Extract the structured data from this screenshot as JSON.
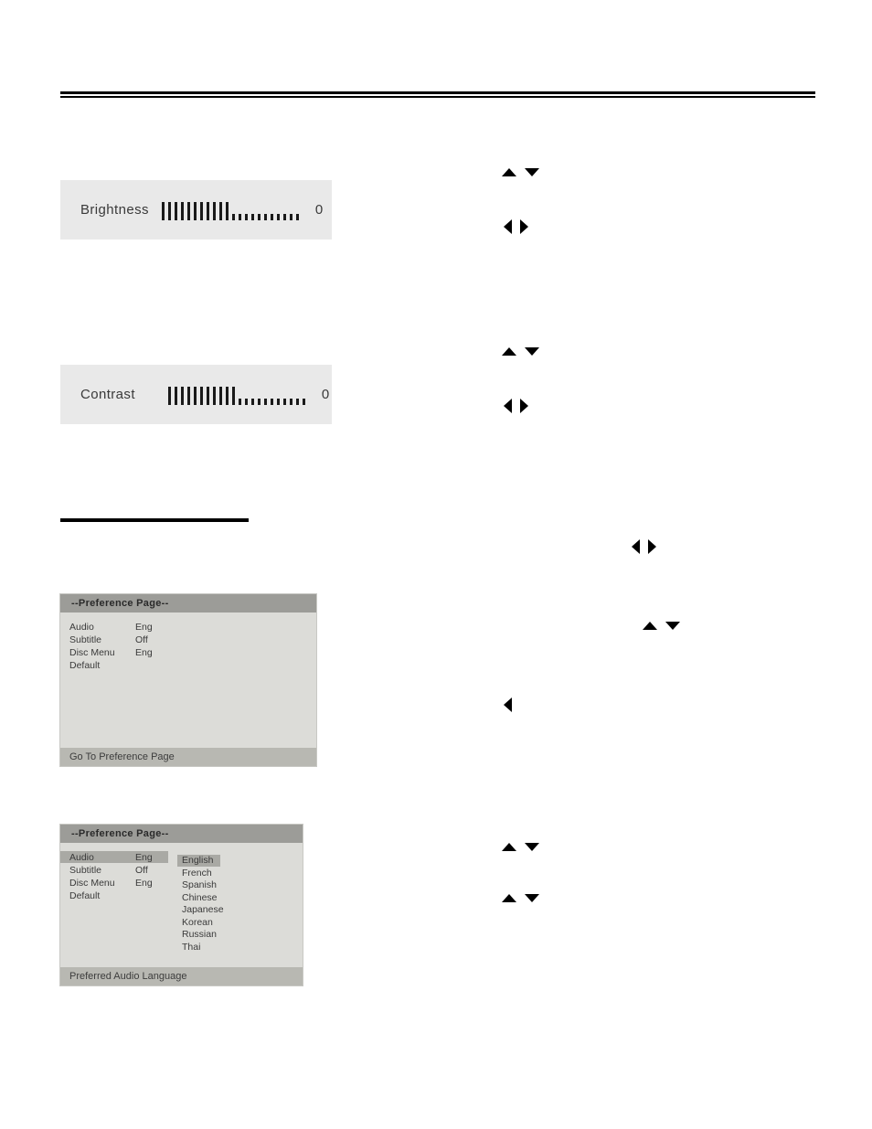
{
  "page": {
    "rules": {
      "top_divider": "double-horizontal-rule",
      "section_divider": "short-heading-rule"
    }
  },
  "osd_sliders": [
    {
      "id": "brightness",
      "label": "Brightness",
      "value": "0",
      "filled_ticks": 11,
      "empty_ticks": 11
    },
    {
      "id": "contrast",
      "label": "Contrast",
      "value": "0",
      "filled_ticks": 11,
      "empty_ticks": 11
    }
  ],
  "nav_arrows": [
    {
      "id": "nav-ud-1",
      "icons": [
        "arrow-up-icon",
        "arrow-down-icon"
      ]
    },
    {
      "id": "nav-lr-1",
      "icons": [
        "arrow-left-icon",
        "arrow-right-icon"
      ]
    },
    {
      "id": "nav-ud-2",
      "icons": [
        "arrow-up-icon",
        "arrow-down-icon"
      ]
    },
    {
      "id": "nav-lr-2",
      "icons": [
        "arrow-left-icon",
        "arrow-right-icon"
      ]
    },
    {
      "id": "nav-lr-3",
      "icons": [
        "arrow-left-icon",
        "arrow-right-icon"
      ]
    },
    {
      "id": "nav-ud-3",
      "icons": [
        "arrow-up-icon",
        "arrow-down-icon"
      ]
    },
    {
      "id": "nav-l-4",
      "icons": [
        "arrow-left-icon"
      ]
    },
    {
      "id": "nav-ud-4",
      "icons": [
        "arrow-up-icon",
        "arrow-down-icon"
      ]
    },
    {
      "id": "nav-ud-5",
      "icons": [
        "arrow-up-icon",
        "arrow-down-icon"
      ]
    }
  ],
  "preference_menu_1": {
    "title": "--Preference Page--",
    "rows": [
      {
        "label": "Audio",
        "value": "Eng",
        "selected": false
      },
      {
        "label": "Subtitle",
        "value": "Off",
        "selected": false
      },
      {
        "label": "Disc Menu",
        "value": "Eng",
        "selected": false
      },
      {
        "label": "Default",
        "value": "",
        "selected": false
      }
    ],
    "footer": "Go To Preference Page"
  },
  "preference_menu_2": {
    "title": "--Preference Page--",
    "rows": [
      {
        "label": "Audio",
        "value": "Eng",
        "selected": true
      },
      {
        "label": "Subtitle",
        "value": "Off",
        "selected": false
      },
      {
        "label": "Disc Menu",
        "value": "Eng",
        "selected": false
      },
      {
        "label": "Default",
        "value": "",
        "selected": false
      }
    ],
    "languages": [
      {
        "label": "English",
        "selected": true
      },
      {
        "label": "French",
        "selected": false
      },
      {
        "label": "Spanish",
        "selected": false
      },
      {
        "label": "Chinese",
        "selected": false
      },
      {
        "label": "Japanese",
        "selected": false
      },
      {
        "label": "Korean",
        "selected": false
      },
      {
        "label": "Russian",
        "selected": false
      },
      {
        "label": "Thai",
        "selected": false
      }
    ],
    "footer": "Preferred Audio Language"
  },
  "colors": {
    "osd_box_bg": "#e9e9e9",
    "menu_bg": "#dcdcd8",
    "menu_title_bg": "#9c9c98",
    "menu_footer_bg": "#b8b8b2",
    "highlight": "#a9a9a4",
    "text": "#3a3a3a",
    "rule": "#000000"
  }
}
